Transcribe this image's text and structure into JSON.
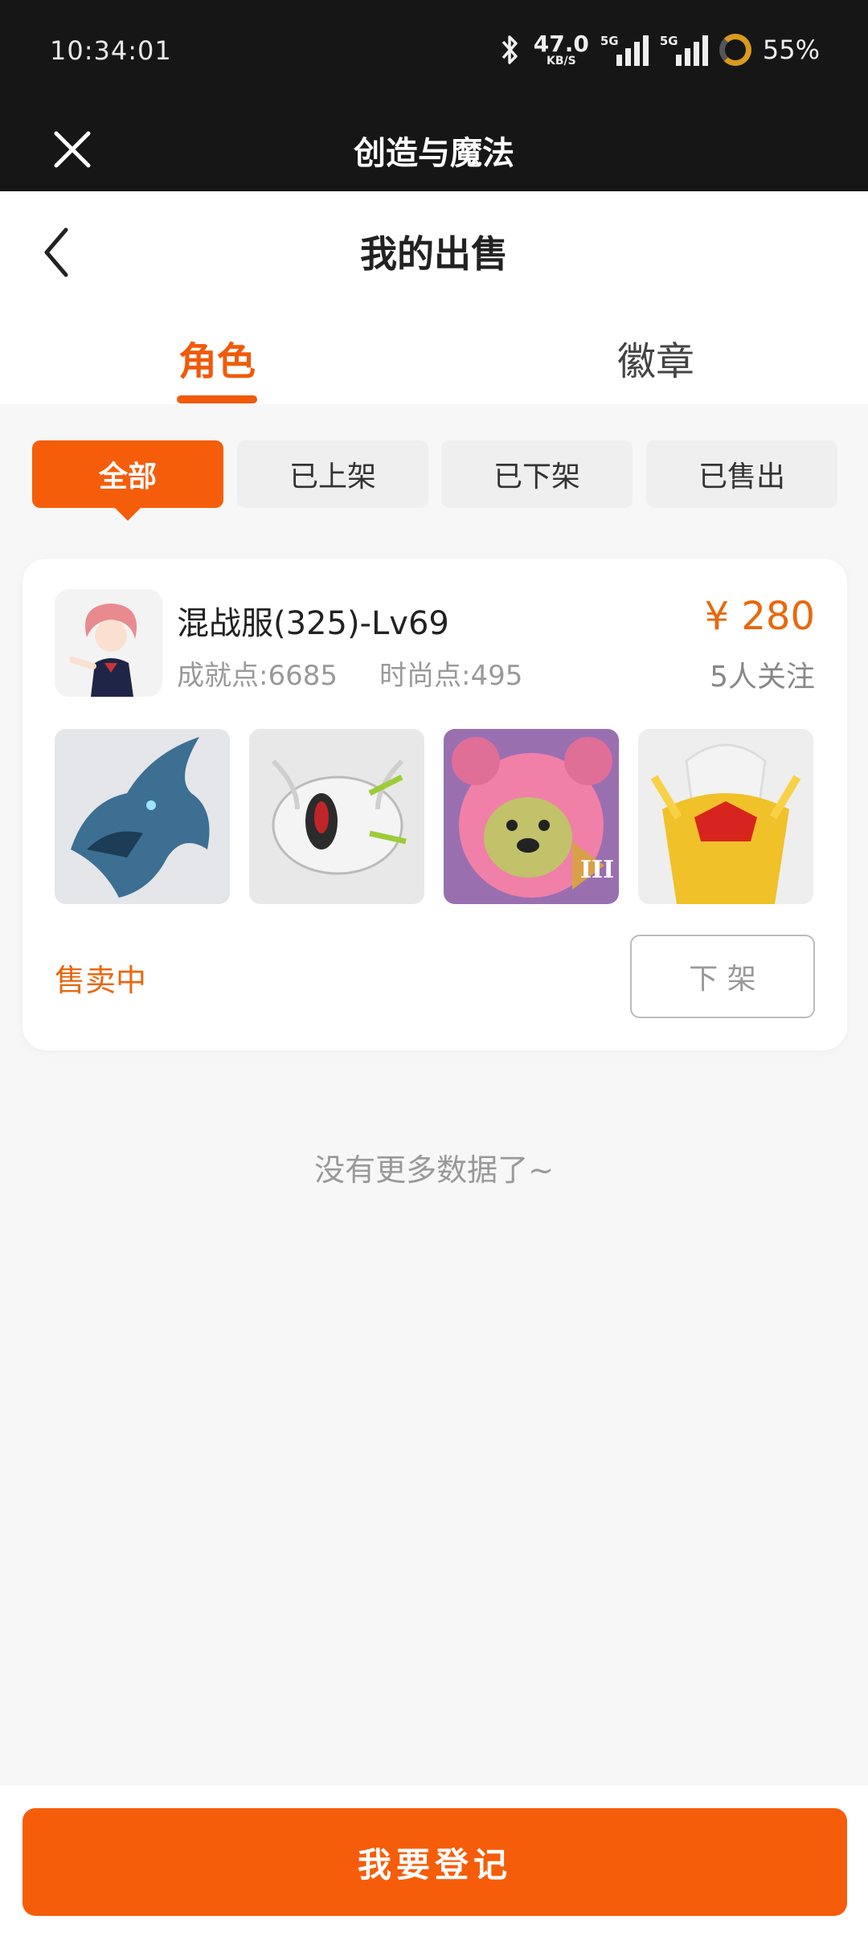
{
  "status_bar": {
    "time": "10:34:01",
    "net_speed": "47.0",
    "net_unit": "KB/S",
    "signal_1": "5G",
    "signal_2": "5G",
    "battery": "55%"
  },
  "app_bar": {
    "title": "创造与魔法"
  },
  "header": {
    "title": "我的出售",
    "tabs": [
      {
        "label": "角色"
      },
      {
        "label": "徽章"
      }
    ]
  },
  "filters": [
    {
      "label": "全部"
    },
    {
      "label": "已上架"
    },
    {
      "label": "已下架"
    },
    {
      "label": "已售出"
    }
  ],
  "listing": {
    "name": "混战服(325)-Lv69",
    "achievement": "成就点:6685",
    "fashion": "时尚点:495",
    "price": "¥ 280",
    "followers": "5人关注",
    "status": "售卖中",
    "action": "下 架"
  },
  "footer_note": "没有更多数据了~",
  "bottom_button": "我要登记",
  "colors": {
    "accent": "#f55d0a",
    "price": "#e8680f"
  }
}
